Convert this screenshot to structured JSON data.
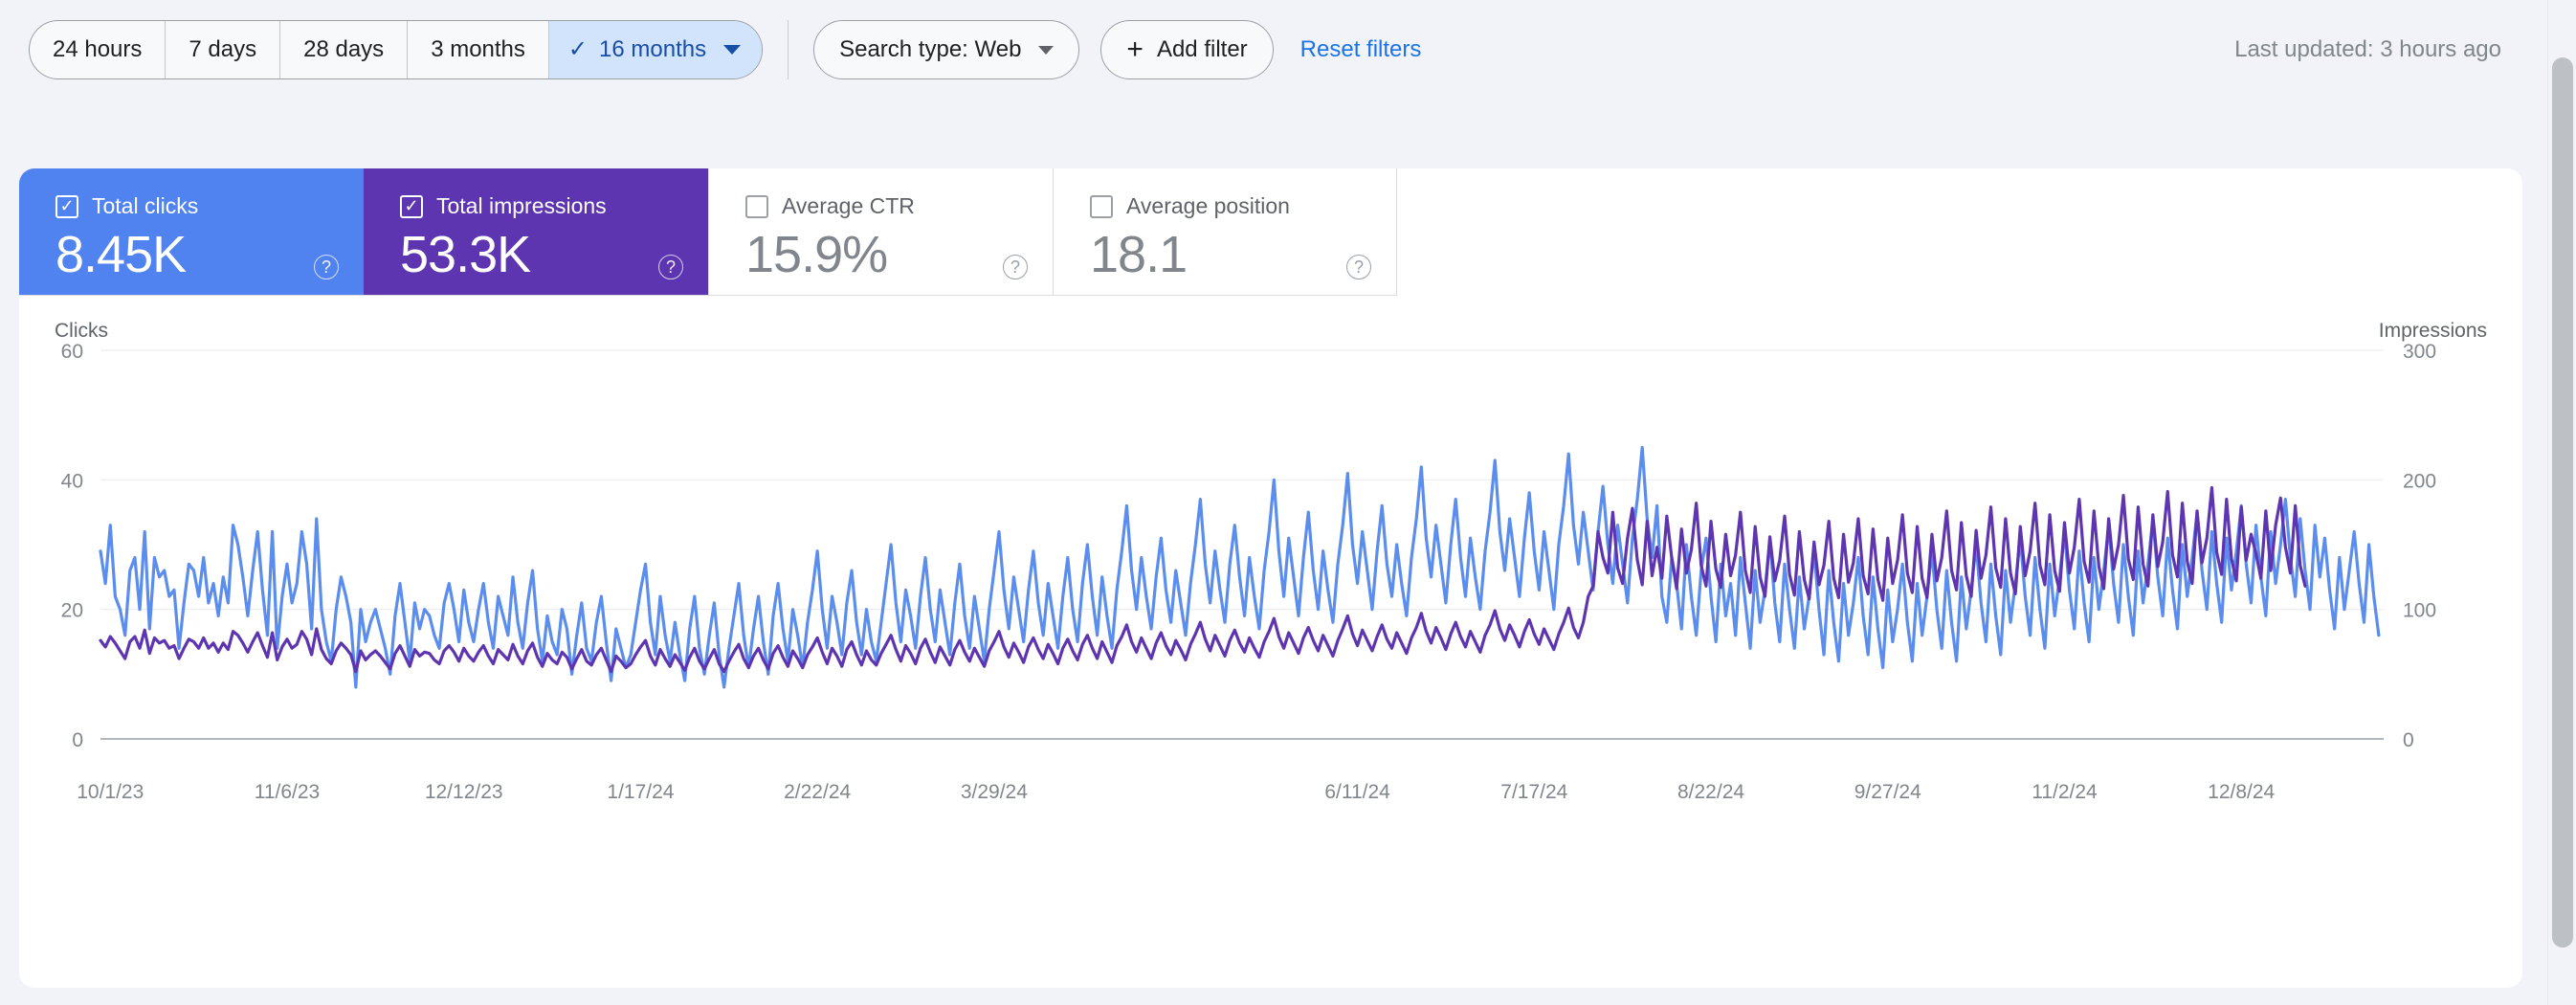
{
  "toolbar": {
    "date_ranges": [
      {
        "label": "24 hours",
        "active": false
      },
      {
        "label": "7 days",
        "active": false
      },
      {
        "label": "28 days",
        "active": false
      },
      {
        "label": "3 months",
        "active": false
      },
      {
        "label": "16 months",
        "active": true
      }
    ],
    "active_check_glyph": "✓",
    "search_type_label": "Search type: Web",
    "add_filter_label": "Add filter",
    "add_filter_plus": "+",
    "reset_filters_label": "Reset filters",
    "last_updated": "Last updated: 3 hours ago"
  },
  "metric_cards": [
    {
      "label": "Total clicks",
      "value": "8.45K",
      "checked": true,
      "color": "#5083F0",
      "help": "?"
    },
    {
      "label": "Total impressions",
      "value": "53.3K",
      "checked": true,
      "color": "#5E35B1",
      "help": "?"
    },
    {
      "label": "Average CTR",
      "value": "15.9%",
      "checked": false,
      "color": "#FFFFFF",
      "help": "?"
    },
    {
      "label": "Average position",
      "value": "18.1",
      "checked": false,
      "color": "#FFFFFF",
      "help": "?"
    }
  ],
  "chart_data": {
    "type": "line",
    "title": "",
    "xlabel": "",
    "left_axis_title": "Clicks",
    "right_axis_title": "Impressions",
    "left_ticks": [
      0,
      20,
      40,
      60
    ],
    "right_ticks": [
      0,
      100,
      200,
      300
    ],
    "ylim": [
      0,
      60
    ],
    "y2lim": [
      0,
      300
    ],
    "grid": true,
    "legend_position": "none",
    "x_tick_labels": [
      "10/1/23",
      "11/6/23",
      "12/12/23",
      "1/17/24",
      "2/22/24",
      "3/29/24",
      "6/11/24",
      "7/17/24",
      "8/22/24",
      "9/27/24",
      "11/2/24",
      "12/8/24"
    ],
    "x_tick_positions": [
      2,
      38,
      74,
      110,
      146,
      182,
      256,
      292,
      328,
      364,
      400,
      436
    ],
    "n_points": 466,
    "series": [
      {
        "name": "Clicks",
        "color": "#5B8DEF",
        "axis": "left",
        "values": [
          29,
          24,
          33,
          22,
          20,
          16,
          26,
          28,
          20,
          32,
          17,
          28,
          25,
          26,
          22,
          23,
          14,
          21,
          27,
          26,
          22,
          28,
          21,
          24,
          19,
          25,
          21,
          33,
          30,
          25,
          19,
          26,
          32,
          23,
          16,
          32,
          14,
          22,
          27,
          21,
          24,
          32,
          27,
          17,
          34,
          20,
          15,
          12,
          20,
          25,
          22,
          18,
          8,
          20,
          15,
          18,
          20,
          17,
          14,
          10,
          19,
          24,
          18,
          12,
          21,
          17,
          20,
          19,
          16,
          14,
          21,
          24,
          20,
          15,
          23,
          18,
          15,
          20,
          24,
          18,
          14,
          22,
          19,
          16,
          25,
          18,
          14,
          21,
          26,
          17,
          12,
          19,
          15,
          13,
          20,
          17,
          10,
          16,
          21,
          14,
          12,
          18,
          22,
          15,
          9,
          17,
          14,
          11,
          13,
          18,
          23,
          27,
          18,
          13,
          22,
          16,
          12,
          18,
          13,
          9,
          17,
          22,
          14,
          10,
          16,
          21,
          13,
          8,
          14,
          19,
          24,
          16,
          11,
          17,
          22,
          15,
          10,
          19,
          24,
          17,
          12,
          20,
          16,
          11,
          18,
          23,
          29,
          20,
          14,
          22,
          18,
          13,
          21,
          26,
          18,
          13,
          20,
          15,
          12,
          18,
          24,
          30,
          21,
          15,
          23,
          19,
          14,
          22,
          28,
          20,
          15,
          23,
          18,
          13,
          21,
          27,
          19,
          14,
          22,
          17,
          12,
          20,
          26,
          32,
          23,
          17,
          25,
          20,
          15,
          23,
          29,
          21,
          16,
          24,
          19,
          14,
          22,
          28,
          20,
          15,
          24,
          30,
          22,
          16,
          25,
          19,
          14,
          23,
          29,
          36,
          26,
          20,
          28,
          22,
          17,
          25,
          31,
          23,
          18,
          26,
          21,
          16,
          24,
          30,
          37,
          27,
          21,
          29,
          23,
          18,
          27,
          33,
          25,
          19,
          28,
          22,
          17,
          26,
          32,
          40,
          29,
          22,
          31,
          25,
          19,
          28,
          35,
          26,
          20,
          29,
          23,
          18,
          27,
          33,
          41,
          30,
          24,
          32,
          26,
          20,
          29,
          36,
          27,
          22,
          30,
          24,
          19,
          28,
          34,
          42,
          31,
          25,
          33,
          27,
          21,
          30,
          37,
          28,
          22,
          31,
          25,
          20,
          29,
          35,
          43,
          32,
          26,
          34,
          28,
          22,
          31,
          38,
          29,
          23,
          32,
          26,
          20,
          30,
          36,
          44,
          33,
          27,
          35,
          29,
          23,
          32,
          39,
          30,
          24,
          33,
          27,
          21,
          31,
          37,
          45,
          34,
          28,
          36,
          22,
          18,
          28,
          24,
          17,
          30,
          22,
          16,
          26,
          31,
          22,
          15,
          27,
          19,
          24,
          16,
          28,
          21,
          14,
          26,
          18,
          23,
          31,
          21,
          15,
          27,
          20,
          14,
          25,
          17,
          22,
          29,
          20,
          13,
          26,
          18,
          12,
          24,
          16,
          21,
          28,
          19,
          13,
          25,
          17,
          11,
          23,
          15,
          20,
          27,
          18,
          12,
          24,
          16,
          22,
          29,
          20,
          14,
          26,
          18,
          12,
          25,
          17,
          23,
          30,
          21,
          15,
          27,
          19,
          13,
          26,
          18,
          24,
          31,
          22,
          16,
          28,
          20,
          14,
          27,
          19,
          25,
          32,
          23,
          17,
          29,
          21,
          15,
          28,
          20,
          26,
          33,
          24,
          18,
          30,
          22,
          16,
          29,
          21,
          27,
          34,
          25,
          19,
          31,
          23,
          17,
          30,
          22,
          28,
          35,
          26,
          20,
          32,
          24,
          18,
          31,
          23,
          29,
          36,
          27,
          21,
          33,
          25,
          19,
          32,
          24,
          30,
          37,
          28,
          22,
          34,
          26,
          20,
          33,
          25,
          31,
          23,
          17,
          28,
          20,
          26,
          32,
          24,
          18,
          30,
          22,
          16
        ]
      },
      {
        "name": "Impressions",
        "color": "#5E35B1",
        "axis": "right",
        "values": [
          76,
          71,
          79,
          74,
          68,
          62,
          75,
          79,
          70,
          84,
          66,
          78,
          74,
          76,
          70,
          72,
          62,
          70,
          77,
          75,
          70,
          78,
          70,
          74,
          67,
          74,
          69,
          83,
          80,
          74,
          67,
          75,
          82,
          72,
          63,
          82,
          61,
          71,
          77,
          70,
          73,
          83,
          77,
          65,
          85,
          69,
          62,
          58,
          68,
          74,
          70,
          65,
          52,
          68,
          61,
          65,
          68,
          64,
          59,
          54,
          66,
          72,
          64,
          56,
          69,
          64,
          67,
          66,
          61,
          58,
          68,
          72,
          67,
          60,
          70,
          64,
          60,
          67,
          72,
          64,
          58,
          69,
          65,
          61,
          73,
          64,
          58,
          68,
          74,
          63,
          56,
          66,
          61,
          58,
          67,
          63,
          54,
          62,
          69,
          60,
          57,
          65,
          70,
          61,
          52,
          64,
          60,
          55,
          58,
          65,
          71,
          76,
          64,
          57,
          69,
          62,
          56,
          65,
          59,
          53,
          63,
          70,
          60,
          54,
          62,
          69,
          58,
          52,
          60,
          67,
          73,
          62,
          55,
          64,
          70,
          61,
          54,
          66,
          72,
          63,
          56,
          68,
          62,
          55,
          65,
          71,
          78,
          67,
          58,
          70,
          64,
          56,
          69,
          75,
          65,
          57,
          68,
          61,
          57,
          66,
          73,
          80,
          69,
          60,
          72,
          66,
          58,
          70,
          77,
          67,
          59,
          71,
          64,
          57,
          69,
          76,
          67,
          60,
          70,
          63,
          56,
          68,
          75,
          83,
          71,
          63,
          74,
          67,
          59,
          71,
          78,
          69,
          62,
          73,
          66,
          58,
          70,
          77,
          68,
          61,
          73,
          80,
          70,
          62,
          75,
          67,
          59,
          72,
          79,
          88,
          75,
          67,
          78,
          70,
          62,
          74,
          82,
          72,
          65,
          76,
          69,
          61,
          73,
          81,
          90,
          77,
          68,
          80,
          72,
          64,
          76,
          84,
          74,
          67,
          78,
          70,
          63,
          75,
          83,
          93,
          79,
          70,
          82,
          74,
          66,
          78,
          86,
          76,
          68,
          80,
          72,
          64,
          76,
          85,
          95,
          81,
          72,
          84,
          76,
          68,
          79,
          88,
          77,
          70,
          82,
          74,
          66,
          78,
          86,
          97,
          83,
          74,
          86,
          78,
          69,
          81,
          90,
          79,
          71,
          83,
          75,
          67,
          80,
          88,
          99,
          85,
          76,
          88,
          80,
          71,
          83,
          92,
          81,
          73,
          85,
          77,
          69,
          81,
          90,
          101,
          86,
          78,
          90,
          110,
          118,
          160,
          140,
          128,
          175,
          132,
          120,
          155,
          178,
          138,
          119,
          168,
          126,
          148,
          124,
          172,
          140,
          116,
          162,
          128,
          146,
          182,
          134,
          118,
          168,
          131,
          117,
          158,
          126,
          142,
          175,
          130,
          113,
          164,
          125,
          110,
          156,
          122,
          138,
          172,
          127,
          111,
          160,
          123,
          108,
          152,
          119,
          134,
          168,
          124,
          109,
          158,
          121,
          136,
          170,
          126,
          112,
          162,
          123,
          107,
          155,
          120,
          138,
          173,
          128,
          113,
          164,
          124,
          109,
          158,
          122,
          140,
          176,
          130,
          115,
          167,
          126,
          110,
          161,
          124,
          142,
          179,
          132,
          117,
          170,
          128,
          112,
          164,
          126,
          145,
          182,
          134,
          119,
          173,
          130,
          114,
          167,
          128,
          148,
          185,
          137,
          121,
          176,
          133,
          116,
          170,
          131,
          150,
          188,
          139,
          123,
          179,
          135,
          118,
          173,
          133,
          152,
          191,
          142,
          125,
          182,
          137,
          120,
          176,
          136,
          155,
          194,
          144,
          127,
          185,
          139,
          122,
          179,
          138,
          158,
          143,
          124,
          176,
          130,
          165,
          186,
          148,
          128,
          180,
          134,
          118
        ]
      }
    ]
  },
  "scrollbar": {
    "present": true
  }
}
